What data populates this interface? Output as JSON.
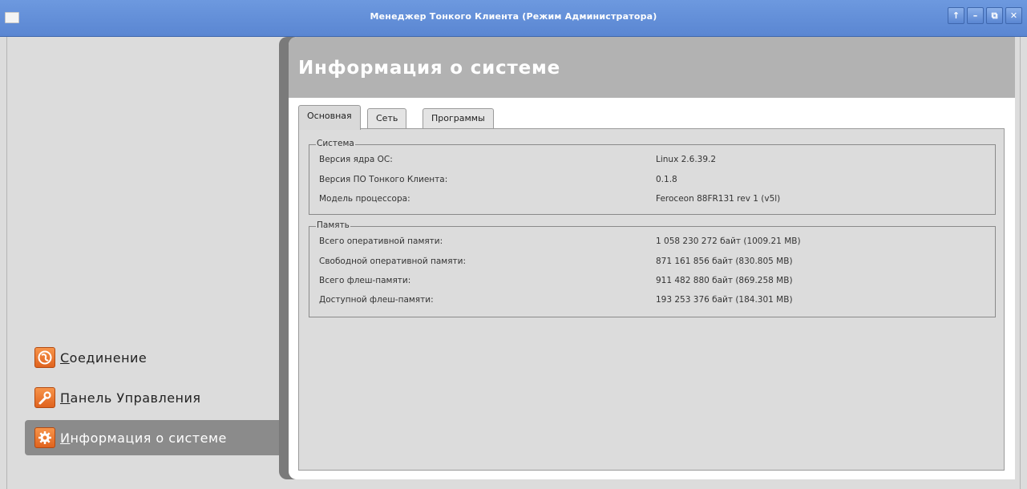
{
  "window": {
    "title": "Менеджер Тонкого Клиента (Режим Администратора)",
    "buttons": [
      "↑",
      "–",
      "⧉",
      "✕"
    ]
  },
  "sidebar": {
    "items": [
      {
        "first": "С",
        "rest": "оединение",
        "icon": "globe-icon",
        "selected": false
      },
      {
        "first": "П",
        "rest": "анель Управления",
        "icon": "wrench-icon",
        "selected": false
      },
      {
        "first": "И",
        "rest": "нформация о системе",
        "icon": "gear-icon",
        "selected": true
      }
    ]
  },
  "panel": {
    "title": "Информация о системе",
    "tabs": [
      "Основная",
      "Сеть",
      "Программы"
    ],
    "active_tab": "Основная"
  },
  "system_group": {
    "legend": "Система",
    "rows": [
      {
        "label": "Версия ядра ОС:",
        "value": "Linux 2.6.39.2"
      },
      {
        "label": "Версия ПО Тонкого Клиента:",
        "value": "0.1.8"
      },
      {
        "label": "Модель процессора:",
        "value": "Feroceon 88FR131 rev 1 (v5l)"
      }
    ]
  },
  "memory_group": {
    "legend": "Память",
    "rows": [
      {
        "label": "Всего оперативной памяти:",
        "value": "1 058 230 272 байт (1009.21 MB)"
      },
      {
        "label": "Свободной оперативной памяти:",
        "value": "871 161 856 байт (830.805 MB)"
      },
      {
        "label": "Всего флеш-памяти:",
        "value": "911 482 880 байт (869.258 MB)"
      },
      {
        "label": "Доступной флеш-памяти:",
        "value": "193 253 376 байт (184.301 MB)"
      }
    ]
  },
  "colors": {
    "titlebar": "#5a86d2",
    "accent_icon": "#e0631e",
    "header": "#b2b2b2",
    "selected_nav": "#8b8b8b"
  }
}
